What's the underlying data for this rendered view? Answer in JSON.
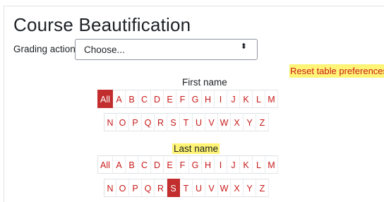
{
  "page": {
    "title": "Course Beautification"
  },
  "grading": {
    "label": "Grading action",
    "selected": "Choose...",
    "arrow": "⬍"
  },
  "reset": {
    "label": "Reset table preferences"
  },
  "first_name": {
    "title": "First name",
    "row1": [
      "All",
      "A",
      "B",
      "C",
      "D",
      "E",
      "F",
      "G",
      "H",
      "I",
      "J",
      "K",
      "L",
      "M"
    ],
    "row2": [
      "N",
      "O",
      "P",
      "Q",
      "R",
      "S",
      "T",
      "U",
      "V",
      "W",
      "X",
      "Y",
      "Z"
    ],
    "active": "All"
  },
  "last_name": {
    "title": "Last name",
    "row1": [
      "All",
      "A",
      "B",
      "C",
      "D",
      "E",
      "F",
      "G",
      "H",
      "I",
      "J",
      "K",
      "L",
      "M"
    ],
    "row2": [
      "N",
      "O",
      "P",
      "Q",
      "R",
      "S",
      "T",
      "U",
      "V",
      "W",
      "X",
      "Y",
      "Z"
    ],
    "active": "S"
  },
  "colors": {
    "link": "#c91a1a",
    "active_bg": "#c22e2e",
    "highlight": "#fff475"
  }
}
